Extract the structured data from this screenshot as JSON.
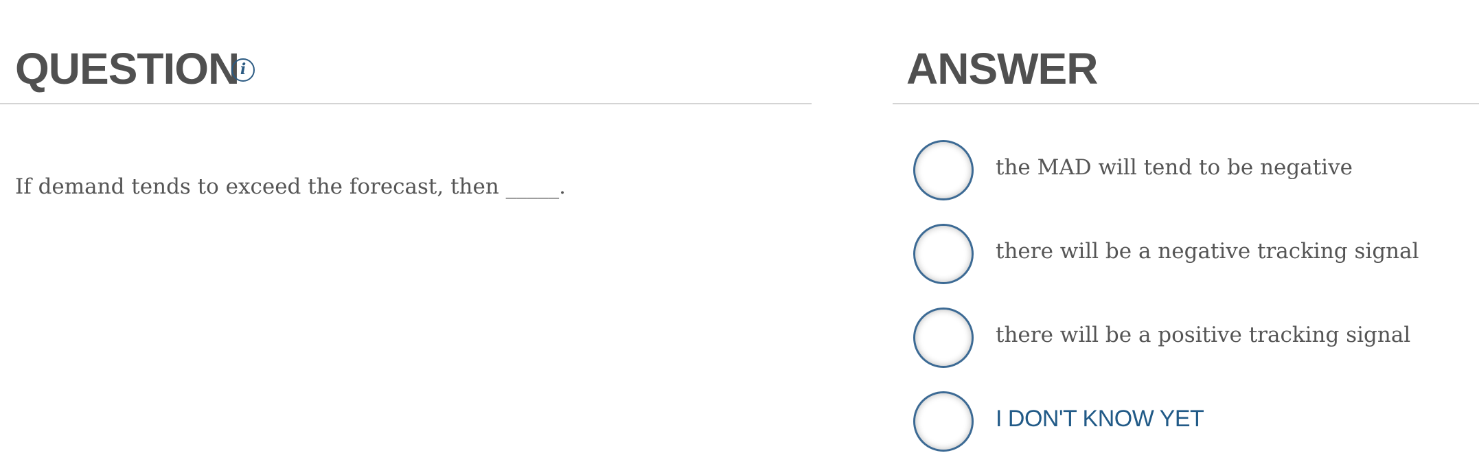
{
  "question_panel": {
    "title": "QUESTION",
    "info_icon_glyph": "i",
    "question_text": "If demand tends to exceed the forecast, then _____."
  },
  "answer_panel": {
    "title": "ANSWER",
    "options": [
      {
        "label": "the MAD will tend to be negative",
        "selected": false
      },
      {
        "label": "there will be a negative tracking signal",
        "selected": false
      },
      {
        "label": "there will be a positive tracking signal",
        "selected": false
      },
      {
        "label": "I DON'T KNOW YET",
        "selected": false
      }
    ]
  },
  "colors": {
    "heading": "#505050",
    "body_text": "#555555",
    "accent_blue": "#2b5a82",
    "radio_border": "#3c6a94",
    "divider": "#d4d4d4"
  }
}
